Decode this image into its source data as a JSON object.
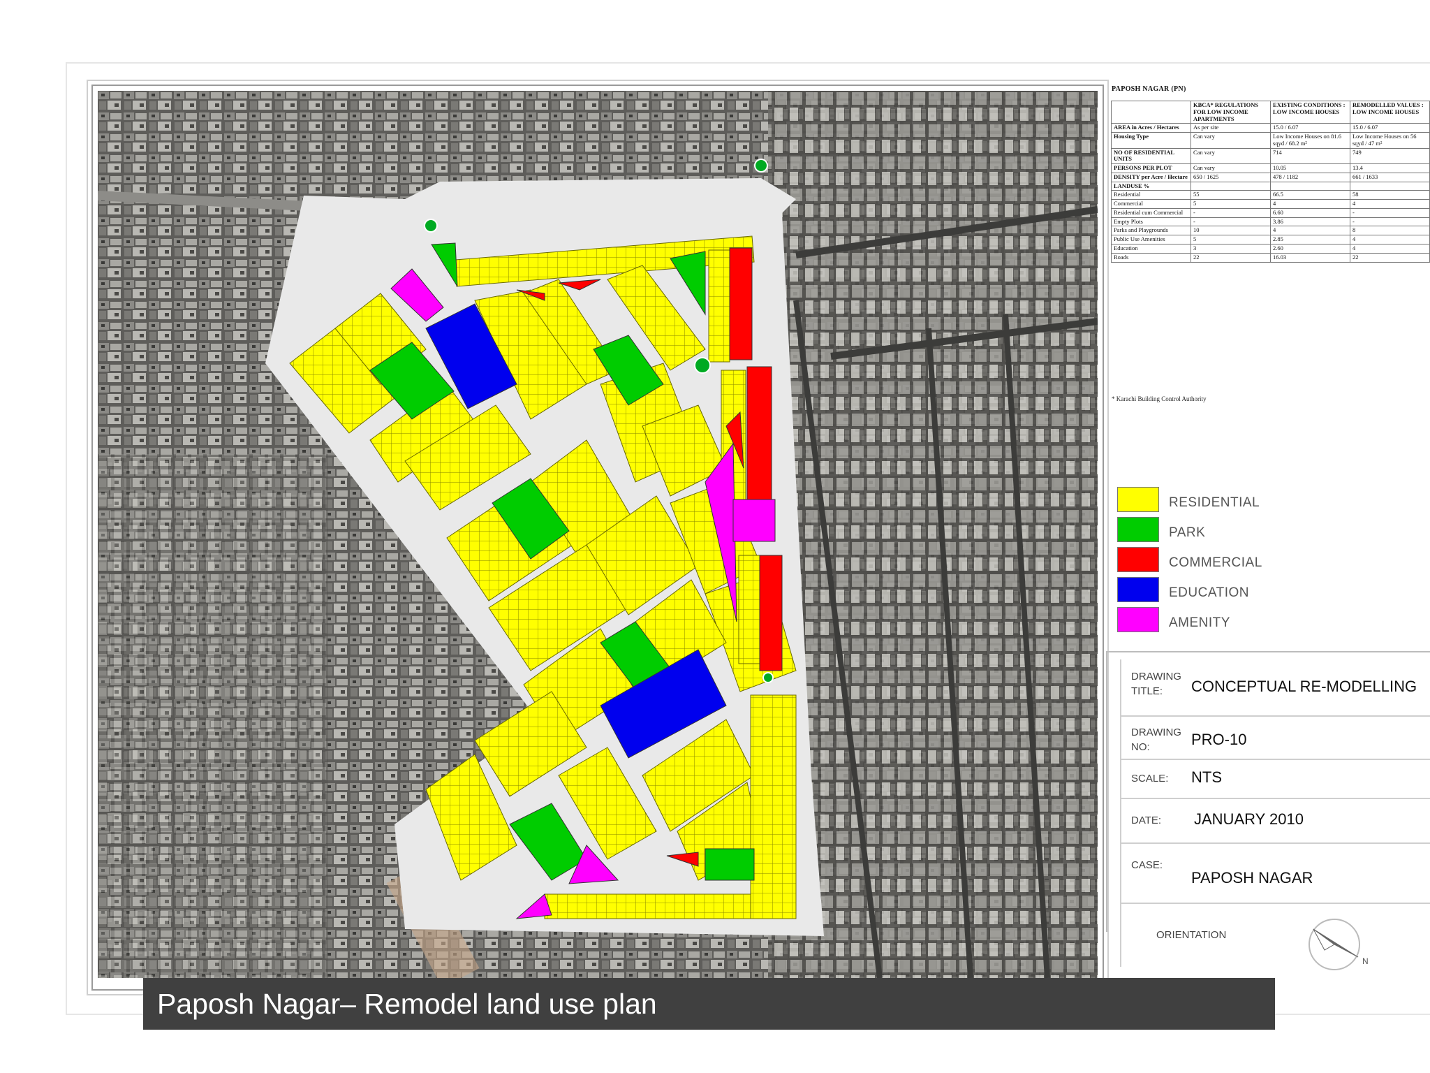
{
  "table": {
    "title": "PAPOSH NAGAR (PN)",
    "headers": [
      "KBCA* REGULATIONS FOR LOW INCOME APARTMENTS",
      "EXISTING CONDITIONS : LOW INCOME HOUSES",
      "REMODELLED VALUES : LOW INCOME HOUSES"
    ],
    "rows": [
      {
        "label": "AREA in Acres / Hectares",
        "values": [
          "As per site",
          "15.0 / 6.07",
          "15.0 / 6.07"
        ]
      },
      {
        "label": "Housing Type",
        "values": [
          "Can vary",
          "Low Income Houses on 81.6 sqyd / 68.2 m²",
          "Low Income Houses on 56 sqyd / 47 m²"
        ]
      },
      {
        "label": "NO OF RESIDENTIAL UNITS",
        "values": [
          "Can vary",
          "714",
          "749"
        ]
      },
      {
        "label": "PERSONS PER PLOT",
        "values": [
          "Can vary",
          "10.05",
          "13.4"
        ]
      },
      {
        "label": "DENSITY per Acre / Hectare",
        "values": [
          "650 / 1625",
          "478 / 1182",
          "661 / 1633"
        ]
      },
      {
        "label": "LANDUSE %",
        "values": [
          "",
          "",
          ""
        ]
      },
      {
        "label": "Residential",
        "values": [
          "55",
          "66.5",
          "58"
        ]
      },
      {
        "label": "Commercial",
        "values": [
          "5",
          "4",
          "4"
        ]
      },
      {
        "label": "Residential cum Commercial",
        "values": [
          "-",
          "6.60",
          "-"
        ]
      },
      {
        "label": "Empty Plots",
        "values": [
          "-",
          "3.86",
          "-"
        ]
      },
      {
        "label": "Parks and Playgrounds",
        "values": [
          "10",
          "4",
          "8"
        ]
      },
      {
        "label": "Public Use Amenities",
        "values": [
          "5",
          "2.85",
          "4"
        ]
      },
      {
        "label": "Education",
        "values": [
          "3",
          "2.60",
          "4"
        ]
      },
      {
        "label": "Roads",
        "values": [
          "22",
          "16.03",
          "22"
        ]
      }
    ],
    "footnote": "* Karachi Building Control Authority"
  },
  "legend": {
    "items": [
      {
        "label": "RESIDENTIAL",
        "color": "#ffff00"
      },
      {
        "label": "PARK",
        "color": "#00cc00"
      },
      {
        "label": "COMMERCIAL",
        "color": "#ff0000"
      },
      {
        "label": "EDUCATION",
        "color": "#0000ee"
      },
      {
        "label": "AMENITY",
        "color": "#ff00ff"
      }
    ]
  },
  "title_block": {
    "drawing_title_key": "DRAWING TITLE:",
    "drawing_title": "CONCEPTUAL RE-MODELLING",
    "drawing_no_key": "DRAWING NO:",
    "drawing_no": "PRO-10",
    "scale_key": "SCALE:",
    "scale": "NTS",
    "date_key": "DATE:",
    "date": "JANUARY 2010",
    "case_key": "CASE:",
    "case": "PAPOSH NAGAR",
    "orientation_key": "ORIENTATION",
    "north_label": "N"
  },
  "caption": "Paposh Nagar– Remodel land use plan"
}
